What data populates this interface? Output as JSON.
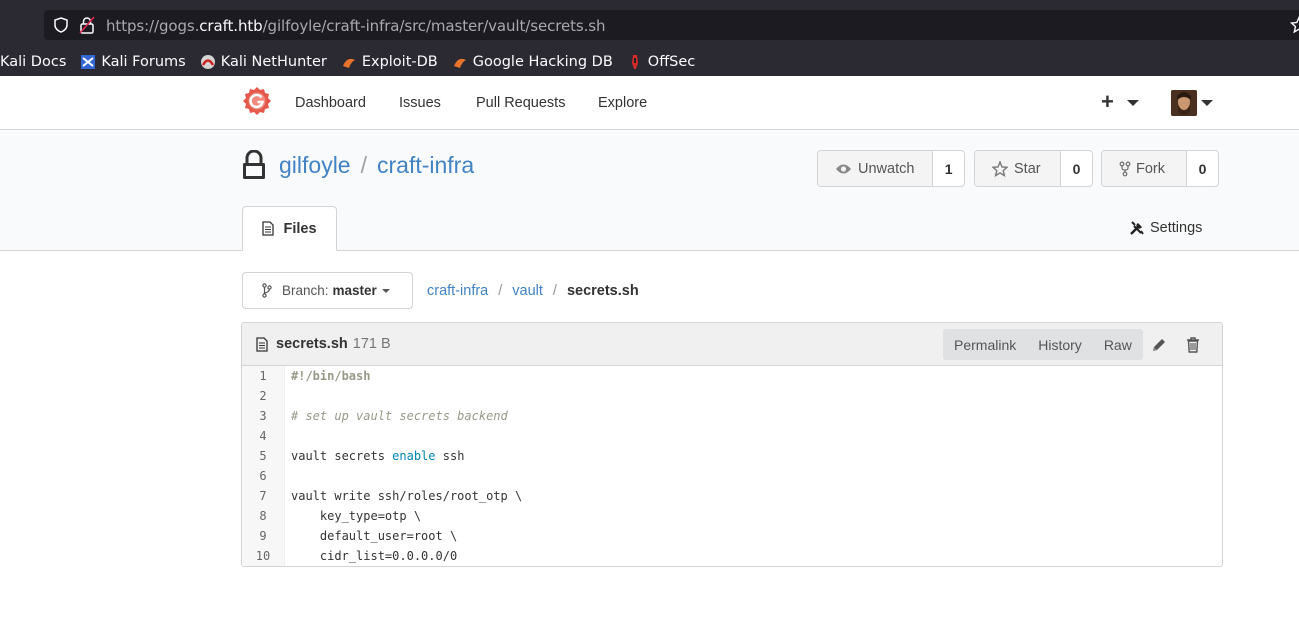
{
  "browser": {
    "url_prefix": "https://gogs.",
    "url_domain": "craft.htb",
    "url_path": "/gilfoyle/craft-infra/src/master/vault/secrets.sh",
    "bookmarks": [
      "Kali Docs",
      "Kali Forums",
      "Kali NetHunter",
      "Exploit-DB",
      "Google Hacking DB",
      "OffSec"
    ]
  },
  "nav": {
    "items": [
      "Dashboard",
      "Issues",
      "Pull Requests",
      "Explore"
    ],
    "plus": "+"
  },
  "repo": {
    "owner": "gilfoyle",
    "separator": "/",
    "name": "craft-infra",
    "watch_label": "Unwatch",
    "watch_count": "1",
    "star_label": "Star",
    "star_count": "0",
    "fork_label": "Fork",
    "fork_count": "0",
    "tab_files": "Files",
    "tab_settings": "Settings"
  },
  "branch": {
    "label": "Branch:",
    "value": "master"
  },
  "breadcrumb": {
    "root": "craft-infra",
    "dir": "vault",
    "file": "secrets.sh",
    "sep": "/"
  },
  "file": {
    "name": "secrets.sh",
    "size": "171 B",
    "actions": [
      "Permalink",
      "History",
      "Raw"
    ],
    "lines": [
      {
        "n": "1",
        "text": "#!/bin/bash",
        "kind": "shebang"
      },
      {
        "n": "2",
        "text": "",
        "kind": "plain"
      },
      {
        "n": "3",
        "text": "# set up vault secrets backend",
        "kind": "comment"
      },
      {
        "n": "4",
        "text": "",
        "kind": "plain"
      },
      {
        "n": "5",
        "pre": "vault secrets ",
        "kw": "enable",
        "post": " ssh",
        "kind": "kw"
      },
      {
        "n": "6",
        "text": "",
        "kind": "plain"
      },
      {
        "n": "7",
        "text": "vault write ssh/roles/root_otp \\",
        "kind": "plain"
      },
      {
        "n": "8",
        "text": "    key_type=otp \\",
        "kind": "plain"
      },
      {
        "n": "9",
        "text": "    default_user=root \\",
        "kind": "plain"
      },
      {
        "n": "10",
        "text": "    cidr_list=0.0.0.0/0",
        "kind": "plain"
      }
    ]
  }
}
